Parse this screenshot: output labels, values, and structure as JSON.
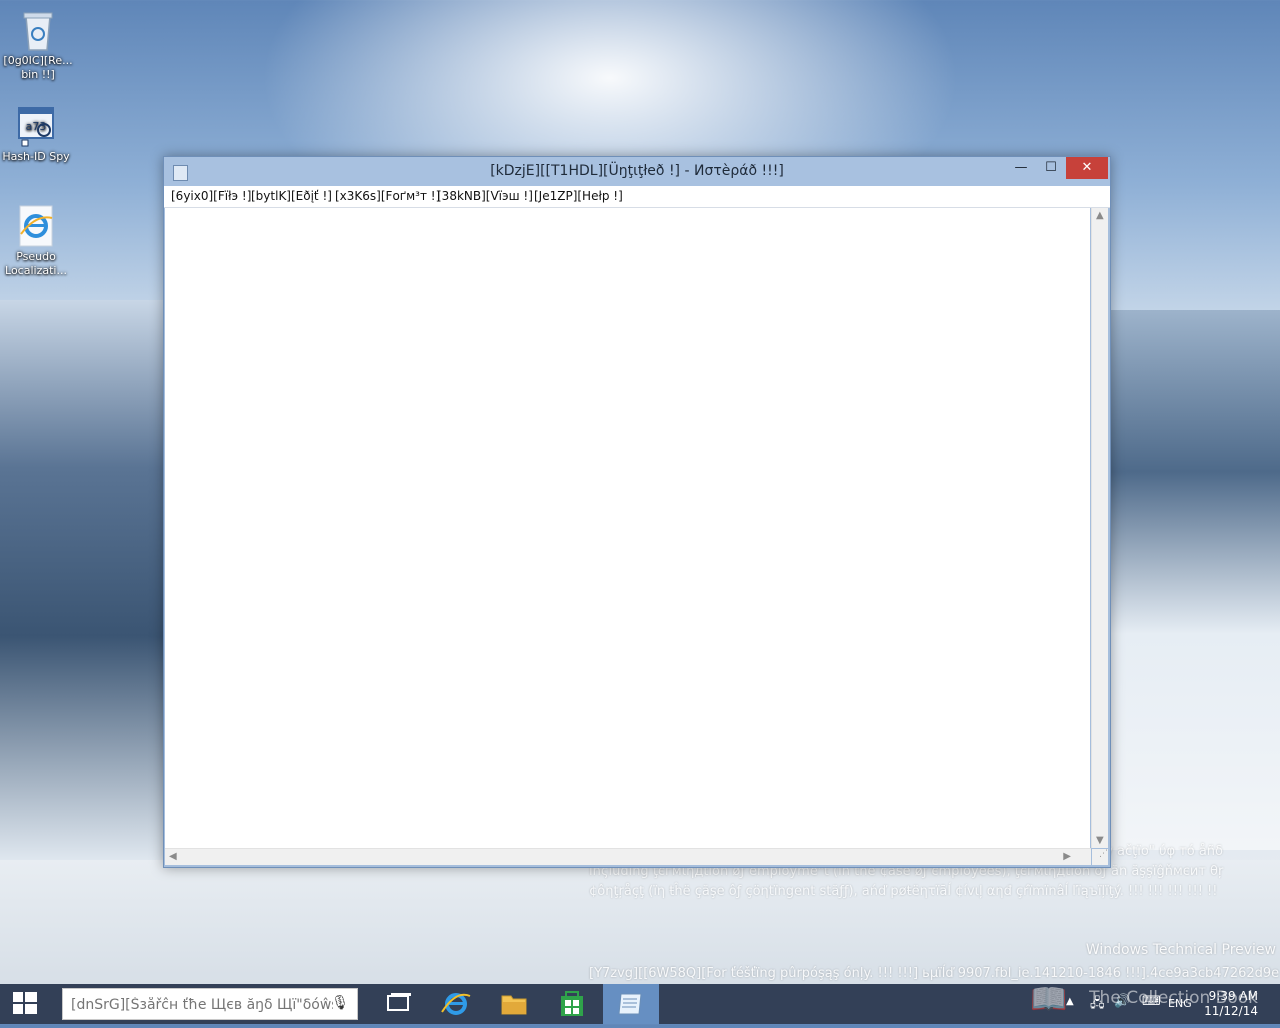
{
  "desktop": {
    "icons": [
      {
        "label": "[0g0IC][Re... bin !!]",
        "icon": "recycle-bin-icon"
      },
      {
        "label": "Hash-ID Spy",
        "icon": "hash-id-icon"
      },
      {
        "label": "Pseudo Localizati...",
        "icon": "internet-explorer-icon"
      }
    ],
    "watermark": {
      "legal_line1": "y аčţïо\" ύφ тó åñδ",
      "legal_line2": "ïnςluding ţєгмιηдtïon øƒ employme\"t (ïñ the ¢ase øƒ єmployees), ţєгмιηдtion ôƒ ăn ăşşïĝňмєит θŗ ¢ôηţŗåçţ (ïη ŧĥë çăşe ôƒ çöηtïngent stăƒƒ), аńď pøŧëητïāĺ ¢ívιļ αηđ çŕïmïnâĺ ľïąъïļïţý. !!! !!! !!! !!! !!",
      "edition": "Windows Technical Preview",
      "build": "[Y7zvg][[6W58Q][For ťéšťïng pûrpόşąş όnļy. !!! !!!] ьµïĺď 9907.fbl_ie.141210-1846 !!!].4ce9a3cb47262d9e"
    }
  },
  "window": {
    "title": "[kDzjE][[T1HDL][Üŋţιţłеð !] - Иστèράð !!!]",
    "controls": {
      "minimize": "—",
      "maximize": "☐",
      "close": "✕"
    },
    "menu": [
      "[6yix0][Fïłэ !]",
      "[bytlK][Eðįť !]",
      "[x3K6s][Fоґм³т !]",
      "[38kNB][Vïэш !]",
      "[Je1ZP][Hеłp !]"
    ],
    "editor_text": ""
  },
  "taskbar": {
    "search_placeholder": "[dnSrG][Šзåřĉн ťħе Щєв ăŋδ Щї\"δóŵš ! ",
    "apps": [
      "task-view-icon",
      "internet-explorer-icon",
      "file-explorer-icon",
      "store-icon",
      "notepad-icon"
    ],
    "tray": {
      "language": "ENG",
      "time": "9:39 AM",
      "date": "11/12/14",
      "corner_text": "The Collection Book"
    }
  }
}
